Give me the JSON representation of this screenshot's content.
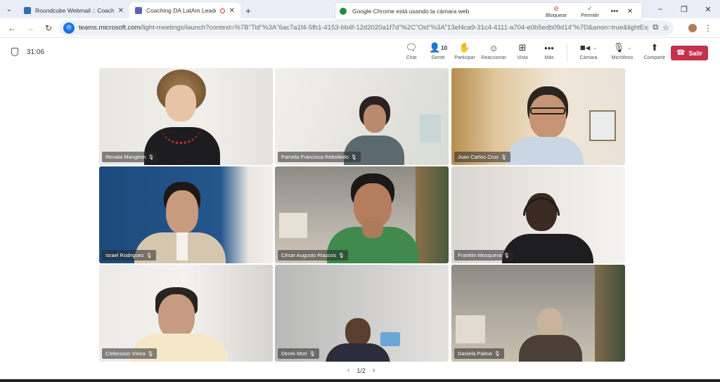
{
  "browser": {
    "tabs": [
      {
        "title": "Roundcube Webmail :: Coachin",
        "active": false,
        "favicon_color": "#2f6fb6"
      },
      {
        "title": "Coaching DA LatAm Leade",
        "active": true,
        "favicon_color": "#5b5fc7",
        "recording": true
      }
    ],
    "new_tab_label": "+",
    "window_controls": [
      "–",
      "❐",
      "✕"
    ],
    "camera_popup": {
      "message": "Google Chrome está usando la cámara web",
      "block_label": "Bloquear",
      "allow_label": "Permitir",
      "more_label": "•••",
      "close_label": "✕"
    },
    "address": {
      "host": "teams.microsoft.com",
      "path": "/light-meetings/launch?context=%7B\"Tid\"%3A\"6ac7a1f4-5fb1-4153-bb4f-12d2020a1f7d\"%2C\"Oid\"%3A\"13ef4ca9-31c4-4111-a704-e0b5edb09d14\"%7D&anon=true&lightExp..."
    }
  },
  "meeting": {
    "timer": "31:06",
    "toolbar": {
      "chat": "Chat",
      "people": "Gente",
      "people_count": "10",
      "raise": "Participar",
      "react": "Reaccionar",
      "view": "Vista",
      "more": "Más",
      "camera": "Cámara",
      "mic": "Micrófono",
      "share": "Compartir",
      "leave": "Salir"
    },
    "accent_color": "#7f85f5",
    "leave_color": "#c4314b",
    "participants": [
      {
        "name": "Renata Mangeon"
      },
      {
        "name": "Pamela Francisca Rebolledo"
      },
      {
        "name": "Juan Carlos Cruz"
      },
      {
        "name": "Israel Rodriguez"
      },
      {
        "name": "César Augusto Riascos"
      },
      {
        "name": "Franklin Mosquera"
      },
      {
        "name": "Clebesson Vieira"
      },
      {
        "name": "Derek Mori"
      },
      {
        "name": "Daniela Palma"
      }
    ],
    "pager": {
      "label": "1/2",
      "prev": "‹",
      "next": "›"
    }
  }
}
